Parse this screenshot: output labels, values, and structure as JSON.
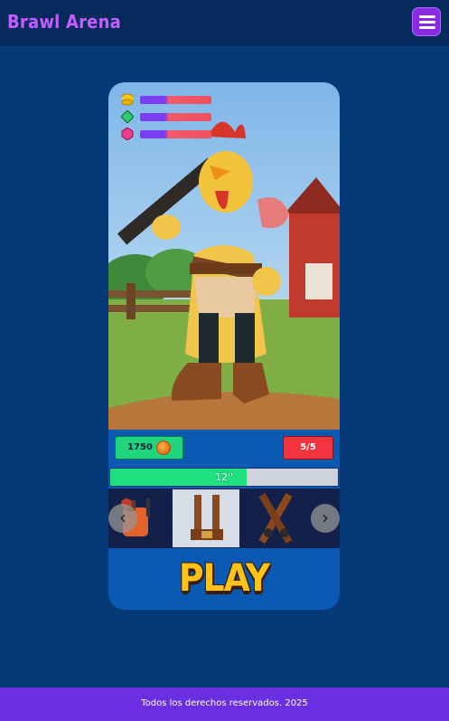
{
  "header": {
    "title": "Brawl Arena",
    "menu_icon": "hamburger-menu-icon"
  },
  "character": {
    "stats": [
      {
        "icon": "coin-stack-icon",
        "color": "#f5c518"
      },
      {
        "icon": "green-gem-icon",
        "color": "#2ecc71"
      },
      {
        "icon": "pink-gem-icon",
        "color": "#e83e8c"
      }
    ],
    "coins": "1750",
    "coin_icon": "orange-coin-icon",
    "count": "5/5",
    "progress_label": "12''",
    "progress_fraction": 0.6
  },
  "carousel": {
    "prev_icon": "chevron-left-icon",
    "next_icon": "chevron-right-icon",
    "items": [
      {
        "icon": "backpack-item-icon"
      },
      {
        "icon": "suspenders-item-icon",
        "selected": true
      },
      {
        "icon": "crossed-straps-item-icon"
      }
    ]
  },
  "play_label": "PLAY",
  "footer": {
    "text": "Todos los derechos reservados. 2025"
  },
  "colors": {
    "background": "#053a78",
    "header": "#062a5c",
    "accent": "#8a2be2",
    "brand": "#c45cff",
    "coin_pill": "#1fd67e",
    "count_pill": "#f2343f",
    "footer": "#6a2fe0",
    "play": "#ffc21a"
  }
}
